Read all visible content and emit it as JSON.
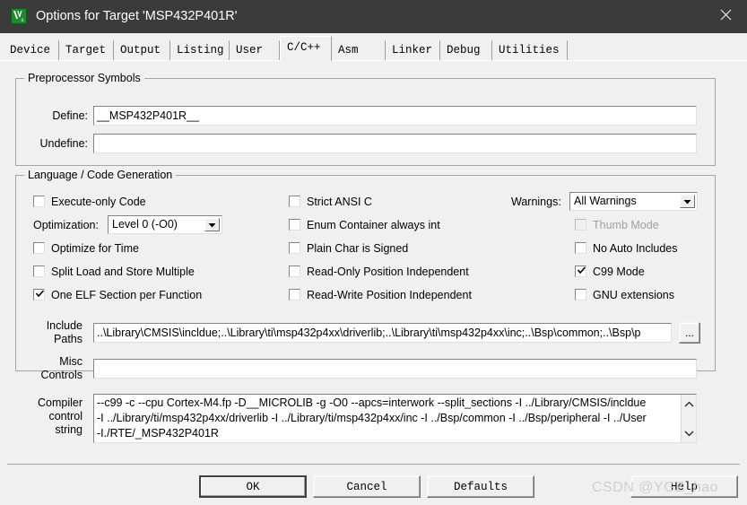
{
  "window": {
    "title": "Options for Target 'MSP432P401R'",
    "icon": "uvision-logo-icon",
    "close_label": "✕",
    "titlebar_color": "#3b3b3b",
    "face_color": "#f0f0f0"
  },
  "tabs": [
    {
      "label": "Device",
      "active": false
    },
    {
      "label": "Target",
      "active": false
    },
    {
      "label": "Output",
      "active": false
    },
    {
      "label": "Listing",
      "active": false
    },
    {
      "label": "User",
      "active": false
    },
    {
      "label": "C/C++",
      "active": true
    },
    {
      "label": "Asm",
      "active": false
    },
    {
      "label": "Linker",
      "active": false
    },
    {
      "label": "Debug",
      "active": false
    },
    {
      "label": "Utilities",
      "active": false
    }
  ],
  "preprocessor": {
    "group_label": "Preprocessor Symbols",
    "define_label": "Define:",
    "define_value": "__MSP432P401R__",
    "undefine_label": "Undefine:",
    "undefine_value": ""
  },
  "language": {
    "group_label": "Language / Code Generation",
    "col1": [
      {
        "label": "Execute-only Code",
        "checked": false,
        "disabled": false
      },
      {
        "label": "Optimize for Time",
        "checked": false,
        "disabled": false
      },
      {
        "label": "Split Load and Store Multiple",
        "checked": false,
        "disabled": false
      },
      {
        "label": "One ELF Section per Function",
        "checked": true,
        "disabled": false
      }
    ],
    "optimization_label": "Optimization:",
    "optimization_value": "Level 0 (-O0)",
    "col2": [
      {
        "label": "Strict ANSI C",
        "checked": false,
        "disabled": false
      },
      {
        "label": "Enum Container always int",
        "checked": false,
        "disabled": false
      },
      {
        "label": "Plain Char is Signed",
        "checked": false,
        "disabled": false
      },
      {
        "label": "Read-Only Position Independent",
        "checked": false,
        "disabled": false
      },
      {
        "label": "Read-Write Position Independent",
        "checked": false,
        "disabled": false
      }
    ],
    "warnings_label": "Warnings:",
    "warnings_value": "All Warnings",
    "col3": [
      {
        "label": "Thumb Mode",
        "checked": false,
        "disabled": true
      },
      {
        "label": "No Auto Includes",
        "checked": false,
        "disabled": false
      },
      {
        "label": "C99 Mode",
        "checked": true,
        "disabled": false
      },
      {
        "label": "GNU extensions",
        "checked": false,
        "disabled": false
      }
    ]
  },
  "paths": {
    "include_label_line1": "Include",
    "include_label_line2": "Paths",
    "include_value": "..\\Library\\CMSIS\\incldue;..\\Library\\ti\\msp432p4xx\\driverlib;..\\Library\\ti\\msp432p4xx\\inc;..\\Bsp\\common;..\\Bsp\\p",
    "browse_label": "...",
    "misc_label_line1": "Misc",
    "misc_label_line2": "Controls",
    "misc_value": ""
  },
  "compiler": {
    "label_line1": "Compiler",
    "label_line2": "control",
    "label_line3": "string",
    "lines": [
      "--c99 -c --cpu Cortex-M4.fp -D__MICROLIB -g -O0 --apcs=interwork --split_sections -I ../Library/CMSIS/incldue",
      "-I ../Library/ti/msp432p4xx/driverlib -I ../Library/ti/msp432p4xx/inc -I ../Bsp/common -I ../Bsp/peripheral -I ../User",
      "-I./RTE/_MSP432P401R"
    ],
    "scroll_up": "scroll-up-icon",
    "scroll_down": "scroll-down-icon"
  },
  "buttons": {
    "ok": "OK",
    "cancel": "Cancel",
    "defaults": "Defaults",
    "help": "Help"
  },
  "watermark": "CSDN @YGZ_hao"
}
